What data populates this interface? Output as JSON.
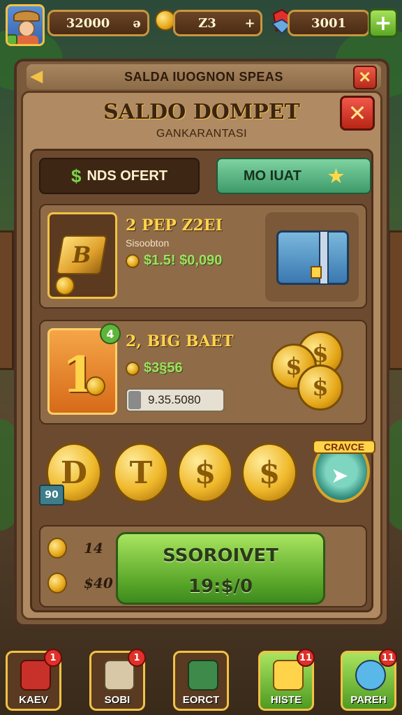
{
  "topbar": {
    "gold": {
      "value": "32000",
      "suffix": "ə"
    },
    "gems": {
      "value": "Z3",
      "suffix": "+"
    },
    "energy": {
      "value": "3001"
    },
    "add_label": "+"
  },
  "window": {
    "title": "SALDA IUOGNON SPEAS",
    "back_glyph": "◀",
    "close_glyph": "✕"
  },
  "panel": {
    "title": "SALDO DOMPET",
    "subtitle": "GANKARANTASI",
    "close_glyph": "✕"
  },
  "tabs": [
    {
      "label": "NDS OFERT",
      "icon": "dollar-icon"
    },
    {
      "label": "MO IUAT",
      "icon": "star-icon"
    }
  ],
  "offers": [
    {
      "title": "2 PEP Z2EI",
      "subtitle": "Sisoobton",
      "price": "$1.5! $0,090",
      "thumb_text": "B"
    },
    {
      "title": "2, BIG BAET",
      "badge": "4",
      "price": "$3§56",
      "input_value": "9.35.5080",
      "thumb_text": "1"
    }
  ],
  "coin_row": {
    "coins": [
      "D",
      "T",
      "$",
      "$"
    ],
    "badge": "90",
    "craft_label": "CRAVCE"
  },
  "purchase": {
    "stat1": "14",
    "stat2": "$40",
    "button_line1": "SSOROIVET",
    "button_line2": "19:$/0"
  },
  "nav": [
    {
      "label": "KAEV",
      "badge": "1",
      "color": "#c8302a"
    },
    {
      "label": "SOBI",
      "badge": "1",
      "color": "#d8c8a8"
    },
    {
      "label": "EORCT",
      "badge": "",
      "color": "#3e8a4a"
    },
    {
      "label": "HISTE",
      "badge": "11",
      "color": "#ffd34a"
    },
    {
      "label": "PAREH",
      "badge": "11",
      "color": "#5ab8e8"
    }
  ],
  "colors": {
    "gold": "#f2c244",
    "green_button": "#5aa72a",
    "close_red": "#b82415"
  }
}
